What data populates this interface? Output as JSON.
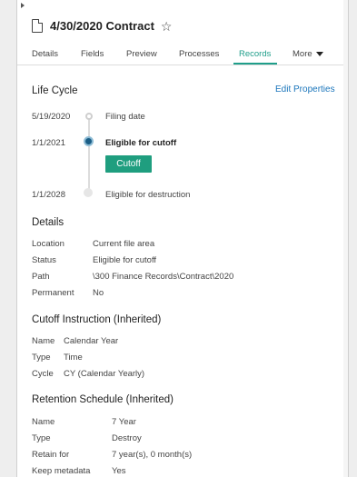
{
  "document": {
    "title": "4/30/2020 Contract",
    "icon": "document-icon",
    "favorite_icon": "star-outline-icon"
  },
  "tabs": [
    {
      "label": "Details",
      "active": false
    },
    {
      "label": "Fields",
      "active": false
    },
    {
      "label": "Preview",
      "active": false
    },
    {
      "label": "Processes",
      "active": false
    },
    {
      "label": "Records",
      "active": true
    },
    {
      "label": "More",
      "active": false,
      "icon": "caret-down-icon"
    }
  ],
  "lifecycle": {
    "title": "Life Cycle",
    "edit_link": "Edit Properties",
    "events": [
      {
        "date": "5/19/2020",
        "label": "Filing date"
      },
      {
        "date": "1/1/2021",
        "label": "Eligible for cutoff"
      },
      {
        "date": "1/1/2028",
        "label": "Eligible for destruction"
      }
    ],
    "cutoff_button": "Cutoff"
  },
  "details": {
    "title": "Details",
    "rows": [
      {
        "key": "Location",
        "value": "Current file area"
      },
      {
        "key": "Status",
        "value": "Eligible for cutoff"
      },
      {
        "key": "Path",
        "value": "\\300 Finance Records\\Contract\\2020"
      },
      {
        "key": "Permanent",
        "value": "No"
      }
    ]
  },
  "cutoff_instruction": {
    "title": "Cutoff Instruction (Inherited)",
    "rows": [
      {
        "key": "Name",
        "value": "Calendar Year"
      },
      {
        "key": "Type",
        "value": "Time"
      },
      {
        "key": "Cycle",
        "value": "CY (Calendar Yearly)"
      }
    ]
  },
  "retention_schedule": {
    "title": "Retention Schedule (Inherited)",
    "rows": [
      {
        "key": "Name",
        "value": "7 Year"
      },
      {
        "key": "Type",
        "value": "Destroy"
      },
      {
        "key": "Retain for",
        "value": "7 year(s), 0 month(s)"
      },
      {
        "key": "Keep metadata",
        "value": "Yes"
      }
    ]
  },
  "colors": {
    "accent": "#1f9e8a",
    "button": "#1f9e7f",
    "link": "#1a75bb",
    "dot_active": "#1b5e86"
  }
}
